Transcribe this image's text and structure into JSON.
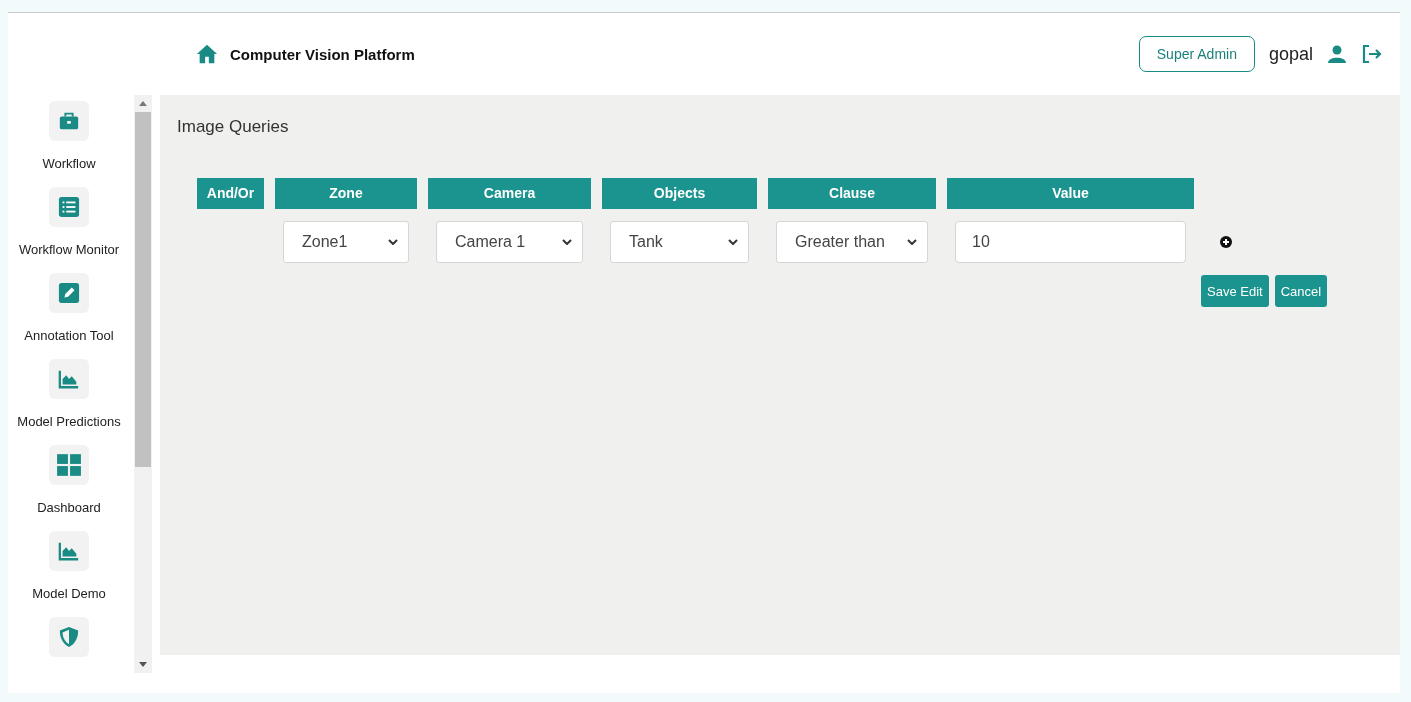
{
  "header": {
    "title": "Computer Vision Platform",
    "role": "Super Admin",
    "user": "gopal"
  },
  "sidebar": {
    "items": [
      {
        "kind": "labeled",
        "label": "Workflow"
      },
      {
        "kind": "labeled",
        "label": "Workflow Monitor"
      },
      {
        "kind": "labeled",
        "label": "Annotation Tool"
      },
      {
        "kind": "labeled",
        "label": "Model Predictions"
      },
      {
        "kind": "labeled",
        "label": "Dashboard"
      },
      {
        "kind": "labeled",
        "label": "Model Demo"
      },
      {
        "kind": "icon_only"
      }
    ]
  },
  "page": {
    "title": "Image Queries"
  },
  "table": {
    "columns": [
      "And/Or",
      "Zone",
      "Camera",
      "Objects",
      "Clause",
      "Value"
    ],
    "rows": [
      {
        "zone": "Zone1",
        "camera": "Camera 1",
        "objects": "Tank",
        "clause": "Greater than",
        "value": "10"
      }
    ]
  },
  "buttons": [
    "Save Edit",
    "Cancel"
  ]
}
